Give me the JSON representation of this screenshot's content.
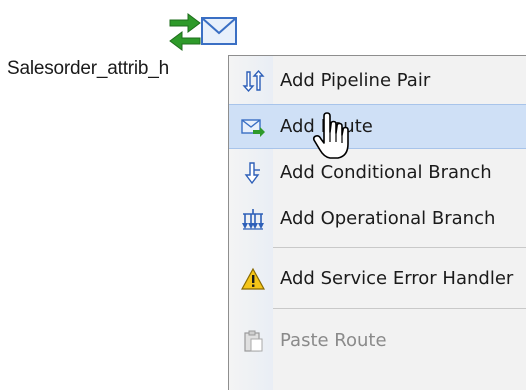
{
  "node": {
    "label": "Salesorder_attrib_h",
    "icon": "route-node-icon"
  },
  "context_menu": {
    "items": [
      {
        "label": "Add Pipeline Pair",
        "icon": "pipeline-pair-icon"
      },
      {
        "label": "Add Route",
        "icon": "route-icon",
        "state": "hovered"
      },
      {
        "label": "Add Conditional Branch",
        "icon": "conditional-branch-icon"
      },
      {
        "label": "Add Operational Branch",
        "icon": "operational-branch-icon"
      },
      {
        "label": "Add Service Error Handler",
        "icon": "warning-icon"
      },
      {
        "label": "Paste Route",
        "icon": "paste-icon",
        "state": "disabled"
      }
    ]
  },
  "colors": {
    "hover_bg": "#cfe0f6",
    "menu_bg": "#f2f2f2",
    "disabled_text": "#8a8a8a",
    "arrow_green": "#2e9a2a",
    "envelope_blue": "#3a6fc4"
  }
}
